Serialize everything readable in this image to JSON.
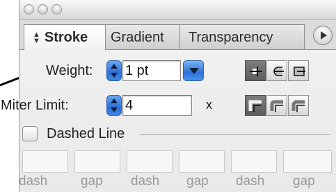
{
  "window": {
    "tabs": [
      {
        "label": "Stroke",
        "active": true
      },
      {
        "label": "Gradient",
        "active": false
      },
      {
        "label": "Transparency",
        "active": false
      }
    ]
  },
  "stroke": {
    "weight_label": "Weight:",
    "weight_value": "1 pt",
    "miter_label": "Miter Limit:",
    "miter_value": "4",
    "miter_suffix": "x",
    "dashed_label": "Dashed Line",
    "dashed_checked": false,
    "dash_fields": [
      {
        "label": "dash",
        "value": ""
      },
      {
        "label": "gap",
        "value": ""
      },
      {
        "label": "dash",
        "value": ""
      },
      {
        "label": "gap",
        "value": ""
      },
      {
        "label": "dash",
        "value": ""
      },
      {
        "label": "gap",
        "value": ""
      }
    ],
    "cap_icons": [
      "butt-cap-icon",
      "round-cap-icon",
      "projecting-cap-icon"
    ],
    "join_icons": [
      "miter-join-icon",
      "round-join-icon",
      "bevel-join-icon"
    ],
    "selected_cap": 0,
    "selected_join": 0
  },
  "colors": {
    "accent_blue": "#2d6fd6",
    "selected_icon_bg": "#5c5c5c",
    "arrow": "#000000"
  }
}
